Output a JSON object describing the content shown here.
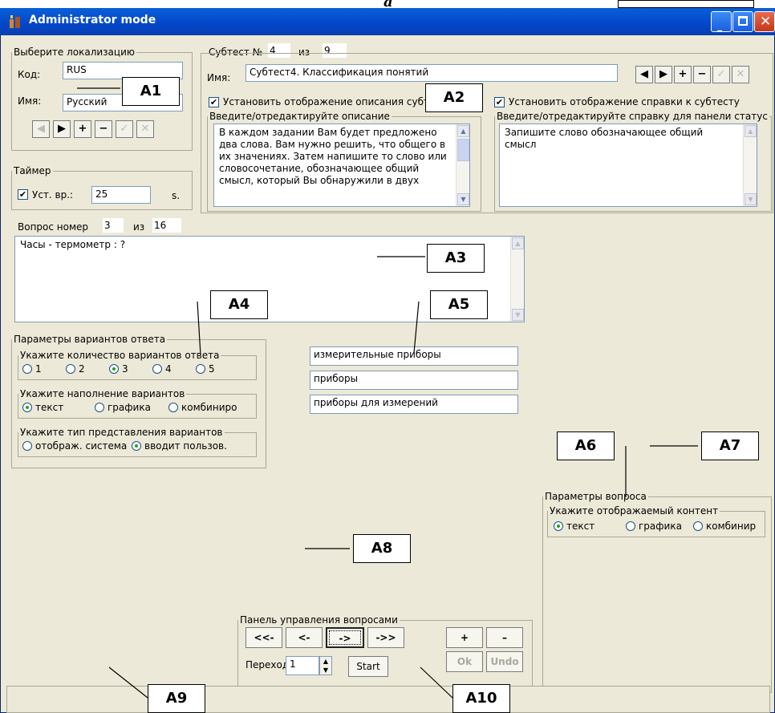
{
  "window": {
    "title": "Administrator mode"
  },
  "figure_label": "a",
  "localization": {
    "legend": "Выберите локализацию",
    "code_label": "Код:",
    "code_value": "RUS",
    "name_label": "Имя:",
    "name_value": "Русский"
  },
  "timer": {
    "legend": "Таймер",
    "checkbox_label": "Уст. вр.:",
    "value": "25",
    "unit": "s."
  },
  "subtest": {
    "label_prefix": "Субтест №",
    "number": "4",
    "of_label": "из",
    "total": "9",
    "name_label": "Имя:",
    "name_value": "Субтест4. Классификация понятий",
    "show_description_label": "Установить отображение описания субтеста",
    "show_help_label": "Установить отображение справки к субтесту",
    "description_legend": "Введите/отредактируйте описание",
    "description_text": "В каждом задании Вам будет предложено два слова. Вам нужно решить, что общего в их значениях. Затем напишите то слово или словосочетание, обозначающее общий смысл, который Вы обнаружили в двух",
    "help_legend": "Введите/отредактируйте справку для панели статус",
    "help_text": "Запишите слово обозначающее общий смысл"
  },
  "question": {
    "label_prefix": "Вопрос номер",
    "number": "3",
    "of_label": "из",
    "total": "16",
    "text": "Часы - термометр : ?"
  },
  "answer_params": {
    "legend": "Параметры вариантов ответа",
    "count_legend": "Укажите количество вариантов ответа",
    "count_options": [
      "1",
      "2",
      "3",
      "4",
      "5"
    ],
    "count_selected": "3",
    "fill_legend": "Укажите наполнение вариантов",
    "fill_options": [
      "текст",
      "графика",
      "комбиниро"
    ],
    "fill_selected": "текст",
    "type_legend": "Укажите тип представления вариантов",
    "type_options": [
      "отображ. система",
      "вводит пользов."
    ],
    "type_selected": "вводит пользов."
  },
  "answers": [
    "измерительные приборы",
    "приборы",
    "приборы для измерений"
  ],
  "question_params": {
    "legend": "Параметры вопроса",
    "content_legend": "Укажите отображаемый контент",
    "content_options": [
      "текст",
      "графика",
      "комбинир"
    ],
    "content_selected": "текст"
  },
  "question_panel": {
    "legend": "Панель управления вопросами",
    "btn_first": "<<-",
    "btn_prev": "<-",
    "btn_next": "->",
    "btn_last": "->>",
    "btn_add": "+",
    "btn_remove": "–",
    "btn_ok": "Ok",
    "btn_undo": "Undo",
    "goto_label": "Переход",
    "goto_value": "1",
    "start_label": "Start"
  },
  "annotations": [
    "A1",
    "A2",
    "A3",
    "A4",
    "A5",
    "A6",
    "A7",
    "A8",
    "A9",
    "A10"
  ]
}
